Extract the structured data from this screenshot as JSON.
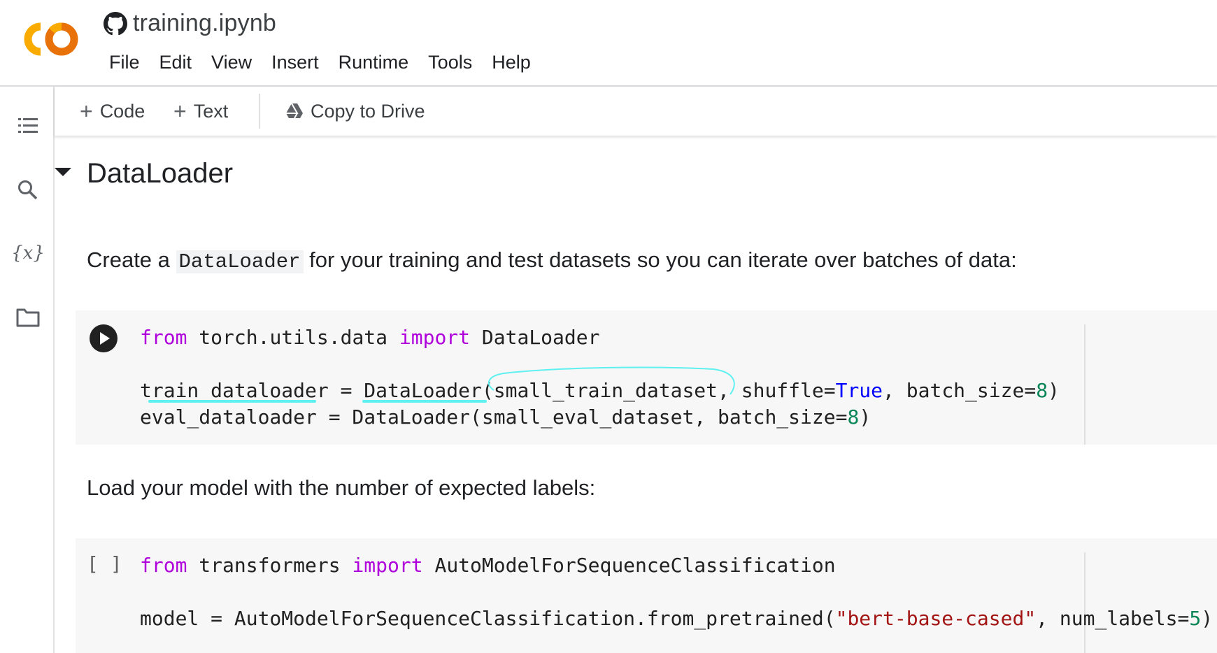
{
  "header": {
    "notebook_title": "training.ipynb",
    "menu": [
      "File",
      "Edit",
      "View",
      "Insert",
      "Runtime",
      "Tools",
      "Help"
    ]
  },
  "toolbar": {
    "add_code_label": "Code",
    "add_text_label": "Text",
    "copy_to_drive_label": "Copy to Drive"
  },
  "sidebar": {
    "icons": [
      "table-of-contents-icon",
      "search-icon",
      "variables-icon",
      "folder-icon"
    ],
    "variables_glyph": "{x}"
  },
  "section": {
    "title": "DataLoader",
    "para1_before": "Create a ",
    "para1_code": "DataLoader",
    "para1_after": " for your training and test datasets so you can iterate over batches of data:",
    "para2": "Load your model with the number of expected labels:"
  },
  "cell1": {
    "line1": {
      "kw1": "from",
      "mod": " torch.utils.data ",
      "kw2": "import",
      "name": " DataLoader"
    },
    "line2": {
      "pre": "train_dataloader = DataLoader(small_train_dataset, shuffle=",
      "bool": "True",
      "mid": ", batch_size=",
      "num": "8",
      "post": ")"
    },
    "line3": {
      "pre": "eval_dataloader = DataLoader(small_eval_dataset, batch_size=",
      "num": "8",
      "post": ")"
    }
  },
  "cell2": {
    "exec_count": "[ ]",
    "line1": {
      "kw1": "from",
      "mod": " transformers ",
      "kw2": "import",
      "name": " AutoModelForSequenceClassification"
    },
    "line2": {
      "pre": "model = AutoModelForSequenceClassification.from_pretrained(",
      "str": "\"bert-base-cased\"",
      "mid": ", num_labels=",
      "num": "5",
      "post": ")"
    }
  },
  "colors": {
    "keyword": "#af00db",
    "boolean": "#0000ff",
    "number": "#098658",
    "string": "#a31515",
    "annotation": "#5ff0f0",
    "logo_orange": "#f9ab00",
    "logo_dark_orange": "#e8710a"
  }
}
